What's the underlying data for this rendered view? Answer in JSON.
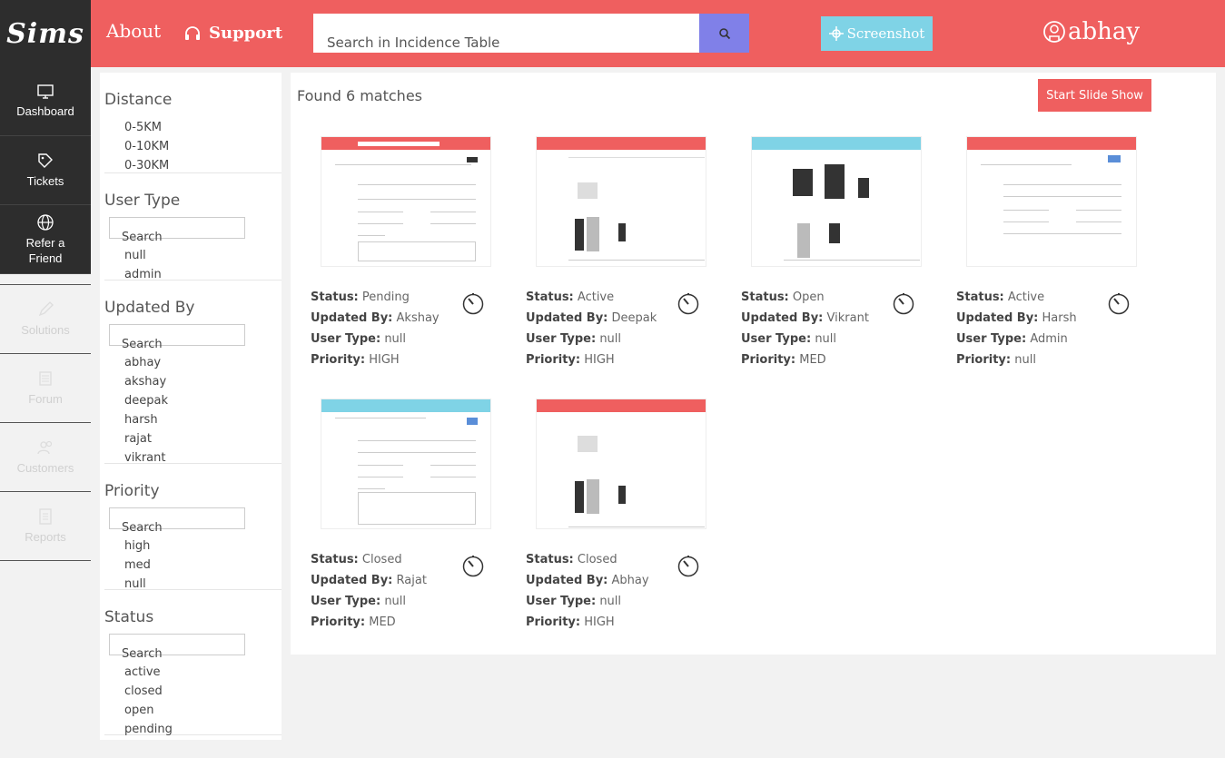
{
  "app": {
    "logo": "Sims"
  },
  "nav": {
    "items": [
      {
        "label": "Dashboard",
        "icon": "monitor-icon",
        "active": true
      },
      {
        "label": "Tickets",
        "icon": "tag-icon",
        "active": true
      },
      {
        "label": "Refer a Friend",
        "icon": "globe-icon",
        "active": true
      },
      {
        "label": "Solutions",
        "icon": "pencil-icon",
        "active": false
      },
      {
        "label": "Forum",
        "icon": "forum-icon",
        "active": false
      },
      {
        "label": "Customers",
        "icon": "users-icon",
        "active": false
      },
      {
        "label": "Reports",
        "icon": "report-icon",
        "active": false
      }
    ]
  },
  "header": {
    "about": "About",
    "support": "Support",
    "search_placeholder": "Search in Incidence Table",
    "screenshot_label": "Screenshot",
    "user": "abhay",
    "color": "#ef5f5f"
  },
  "filters": {
    "distance": {
      "title": "Distance",
      "options": [
        "0-5KM",
        "0-10KM",
        "0-30KM"
      ]
    },
    "user_type": {
      "title": "User Type",
      "search": "Search",
      "options": [
        "null",
        "admin"
      ]
    },
    "updated_by": {
      "title": "Updated By",
      "search": "Search",
      "options": [
        "abhay",
        "akshay",
        "deepak",
        "harsh",
        "rajat",
        "vikrant"
      ]
    },
    "priority": {
      "title": "Priority",
      "search": "Search",
      "options": [
        "high",
        "med",
        "null"
      ]
    },
    "status": {
      "title": "Status",
      "search": "Search",
      "options": [
        "active",
        "closed",
        "open",
        "pending"
      ]
    }
  },
  "results": {
    "found_text": "Found 6 matches",
    "slideshow_label": "Start Slide Show",
    "labels": {
      "status": "Status:",
      "updated_by": "Updated By:",
      "user_type": "User Type:",
      "priority": "Priority:"
    },
    "cards": [
      {
        "status": "Pending",
        "updated_by": "Akshay",
        "user_type": "null",
        "priority": "HIGH"
      },
      {
        "status": "Active",
        "updated_by": "Deepak",
        "user_type": "null",
        "priority": "HIGH"
      },
      {
        "status": "Open",
        "updated_by": "Vikrant",
        "user_type": "null",
        "priority": "MED"
      },
      {
        "status": "Active",
        "updated_by": "Harsh",
        "user_type": "Admin",
        "priority": "null"
      },
      {
        "status": "Closed",
        "updated_by": "Rajat",
        "user_type": "null",
        "priority": "MED"
      },
      {
        "status": "Closed",
        "updated_by": "Abhay",
        "user_type": "null",
        "priority": "HIGH"
      }
    ]
  }
}
